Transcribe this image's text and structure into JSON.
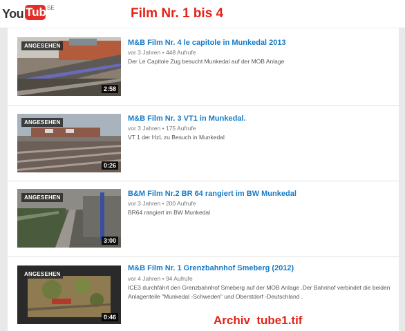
{
  "header": {
    "logo_you": "You",
    "logo_tube": "Tube",
    "logo_region": "SE",
    "title": "Film Nr. 1 bis 4"
  },
  "videos": [
    {
      "title": "M&B Film Nr. 4 le capitole in Munkedal 2013",
      "meta": "vor 3 Jahren • 448 Aufrufe",
      "description": "Der Le Capitole Zug besucht Munkedal auf der MOB Anlage",
      "watched_badge": "ANGESEHEN",
      "duration": "2:58"
    },
    {
      "title": "M&B Film Nr. 3 VT1 in Munkedal.",
      "meta": "vor 3 Jahren • 175 Aufrufe",
      "description": "VT 1 der HzL zu Besuch in Munkedal",
      "watched_badge": "ANGESEHEN",
      "duration": "0:26"
    },
    {
      "title": "B&M Film Nr.2 BR 64 rangiert im BW Munkedal",
      "meta": "vor 3 Jahren • 200 Aufrufe",
      "description": "BR64 rangiert im BW Munkedal",
      "watched_badge": "ANGESEHEN",
      "duration": "3:00"
    },
    {
      "title": "M&B Film Nr. 1 Grenzbahnhof Smeberg (2012)",
      "meta": "vor 4 Jahren • 94 Aufrufe",
      "description": "ICE3 durchfährt den Grenzbahnhof Smeberg auf der MOB Anlage .Der Bahnhof verbindet die beiden Anlagenteile \"Munkedal -Schweden\" und Oberstdorf -Deutschland .",
      "watched_badge": "ANGESEHEN",
      "duration": "0:46"
    }
  ],
  "footer_caption": "Archiv  tube1.tif",
  "colors": {
    "title_red": "#e62117",
    "link_blue": "#167ac6",
    "logo_red": "#e52d27"
  }
}
